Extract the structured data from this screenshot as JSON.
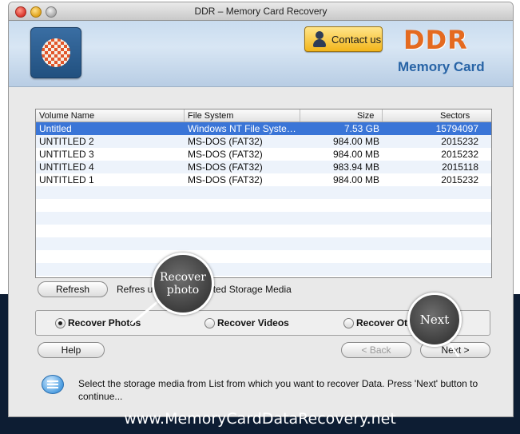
{
  "window": {
    "title": "DDR – Memory Card Recovery"
  },
  "header": {
    "contact_button": "Contact us",
    "brand_name": "DDR",
    "brand_subtitle": "Memory Card",
    "brand_color": "#e46a20",
    "accent_color": "#2864a6"
  },
  "volume_table": {
    "columns": [
      "Volume Name",
      "File System",
      "Size",
      "Sectors"
    ],
    "rows": [
      {
        "name": "Untitled",
        "fs": "Windows NT File Syste…",
        "size": "7.53  GB",
        "sectors": "15794097",
        "selected": true
      },
      {
        "name": "UNTITLED 2",
        "fs": "MS-DOS (FAT32)",
        "size": "984.00  MB",
        "sectors": "2015232"
      },
      {
        "name": "UNTITLED 3",
        "fs": "MS-DOS (FAT32)",
        "size": "984.00  MB",
        "sectors": "2015232"
      },
      {
        "name": "UNTITLED 4",
        "fs": "MS-DOS (FAT32)",
        "size": "983.94  MB",
        "sectors": "2015118"
      },
      {
        "name": "UNTITLED 1",
        "fs": "MS-DOS (FAT32)",
        "size": "984.00  MB",
        "sectors": "2015232"
      }
    ],
    "selection_color": "#3a75d7"
  },
  "refresh": {
    "button": "Refresh",
    "description": "Refres           urrently connected Storage Media"
  },
  "options": {
    "items": [
      {
        "label": "Recover Photos",
        "selected": true
      },
      {
        "label": "Recover Videos",
        "selected": false
      },
      {
        "label": "Recover Ot",
        "selected": false
      }
    ]
  },
  "nav": {
    "help": "Help",
    "back": "< Back",
    "next": "Next >"
  },
  "info": {
    "icon": "chat-bubble-icon",
    "message": "Select the storage media from List from which you want to recover Data. Press 'Next' button to continue..."
  },
  "callouts": {
    "recover_photo": "Recover photo",
    "next": "Next"
  },
  "footer": {
    "url": "www.MemoryCardDataRecovery.net"
  }
}
